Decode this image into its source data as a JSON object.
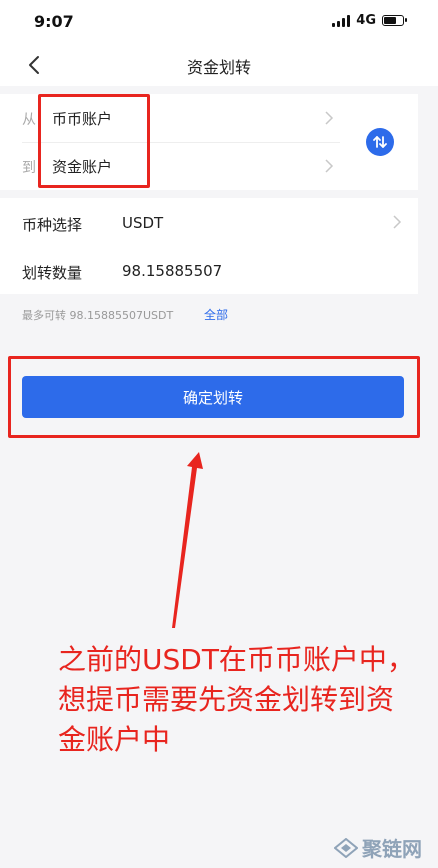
{
  "status_bar": {
    "time": "9:07",
    "network": "4G"
  },
  "nav": {
    "title": "资金划转"
  },
  "transfer": {
    "from_label": "从",
    "from_account": "币币账户",
    "to_label": "到",
    "to_account": "资金账户"
  },
  "form": {
    "coin_label": "币种选择",
    "coin_value": "USDT",
    "amount_label": "划转数量",
    "amount_value": "98.15885507",
    "max_text": "最多可转 98.15885507USDT",
    "all_label": "全部"
  },
  "confirm_label": "确定划转",
  "annotation": {
    "text": "之前的USDT在币币账户中，想提币需要先资金划转到资金账户中"
  },
  "watermark": "聚链网",
  "colors": {
    "accent": "#2d6bea",
    "annotation": "#e8251f"
  }
}
